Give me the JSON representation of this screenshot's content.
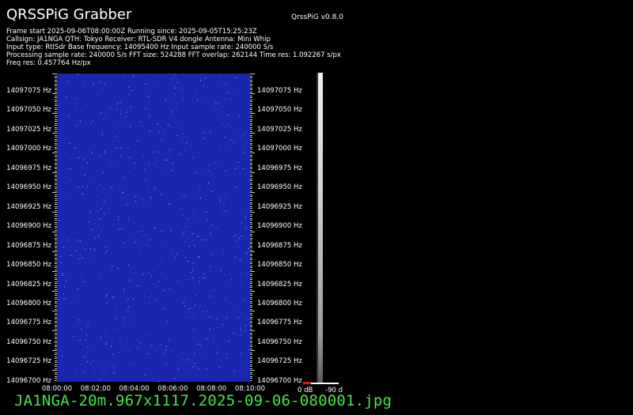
{
  "header": {
    "title": "QRSSPiG Grabber",
    "version": "QrssPiG v0.8.0"
  },
  "info_lines": [
    "Frame start 2025-09-06T08:00:00Z Running since: 2025-09-05T15:25:23Z",
    "Callsign: JA1NGA QTH: Tokyo Receiver: RTL-SDR V4 dongle Antenna: Mini Whip",
    "Input type: RtlSdr Base frequency: 14095400 Hz Input sample rate: 240000 S/s",
    "Processing sample rate: 240000 S/s FFT size: 524288 FFT overlap: 262144 Time res: 1.092267 s/px",
    "Freq res: 0.457764 Hz/px"
  ],
  "y_axis_labels": [
    "14097075 Hz",
    "14097050 Hz",
    "14097025 Hz",
    "14097000 Hz",
    "14096975 Hz",
    "14096950 Hz",
    "14096925 Hz",
    "14096900 Hz",
    "14096875 Hz",
    "14096850 Hz",
    "14096825 Hz",
    "14096800 Hz",
    "14096775 Hz",
    "14096750 Hz",
    "14096725 Hz",
    "14096700 Hz"
  ],
  "x_axis_labels": [
    "08:00:00",
    "08:02:00",
    "08:04:00",
    "08:06:00",
    "08:08:00",
    "08:10:00"
  ],
  "colorbar": {
    "top_label": "0 dB",
    "bottom_label": "-90 d"
  },
  "colors": {
    "waterfall_bg": "#1b26b0",
    "filename": "#4ee04e"
  },
  "filename": "JA1NGA-20m.967x1117.2025-09-06-080001.jpg"
}
